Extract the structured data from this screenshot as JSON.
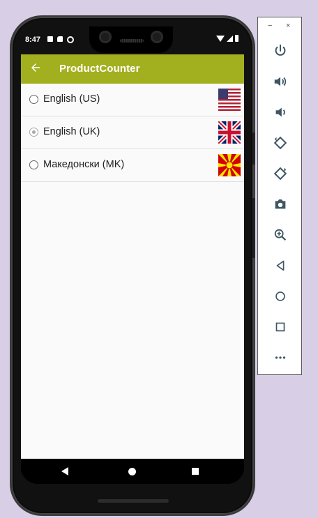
{
  "status_bar": {
    "time": "8:47",
    "icons": [
      "notification-square-icon",
      "sd-card-icon",
      "at-sign-icon",
      "wifi-icon",
      "signal-icon",
      "battery-icon"
    ]
  },
  "app_bar": {
    "title": "ProductCounter",
    "background": "#a2b01f",
    "back_icon": "arrow-left-icon"
  },
  "languages": [
    {
      "label": "English (US)",
      "selected": false,
      "flag": "us-flag"
    },
    {
      "label": "English (UK)",
      "selected": true,
      "flag": "uk-flag"
    },
    {
      "label": "Македонски (MK)",
      "selected": false,
      "flag": "mk-flag"
    }
  ],
  "nav_bar": {
    "buttons": [
      "back-triangle-icon",
      "home-circle-icon",
      "recents-square-icon"
    ]
  },
  "emulator_toolbar": {
    "minimize": "−",
    "close": "×",
    "buttons": [
      "power-icon",
      "volume-up-icon",
      "volume-down-icon",
      "rotate-left-icon",
      "rotate-right-icon",
      "camera-icon",
      "zoom-icon",
      "back-icon",
      "home-icon",
      "overview-icon",
      "more-icon"
    ],
    "more_label": "•••"
  }
}
